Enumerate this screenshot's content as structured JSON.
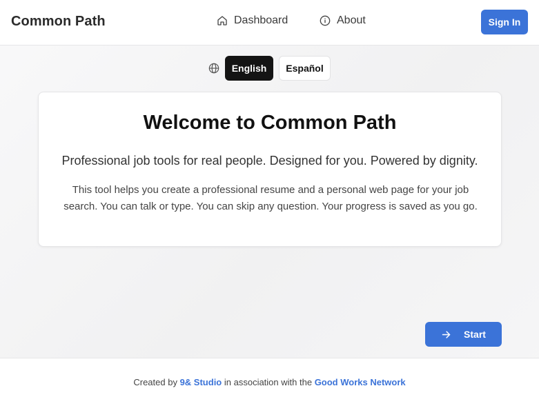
{
  "header": {
    "brand": "Common Path",
    "nav": [
      {
        "label": "Dashboard",
        "icon": "home-icon"
      },
      {
        "label": "About",
        "icon": "info-icon"
      }
    ],
    "signin_label": "Sign In"
  },
  "language": {
    "icon": "globe-icon",
    "options": [
      {
        "label": "English",
        "selected": true
      },
      {
        "label": "Español",
        "selected": false
      }
    ]
  },
  "welcome": {
    "title": "Welcome to Common Path",
    "tagline": "Professional job tools for real people. Designed for you. Powered by dignity.",
    "description": "This tool helps you create a professional resume and a personal web page for your job search. You can talk or type. You can skip any question. Your progress is saved as you go."
  },
  "actions": {
    "start_label": "Start",
    "start_icon": "arrow-right-icon"
  },
  "footer": {
    "prefix": "Created by",
    "studio_link": "9& Studio",
    "middle": "in association with the",
    "network_link": "Good Works Network"
  },
  "colors": {
    "accent": "#3b73d8",
    "selected_language_bg": "#141414"
  }
}
